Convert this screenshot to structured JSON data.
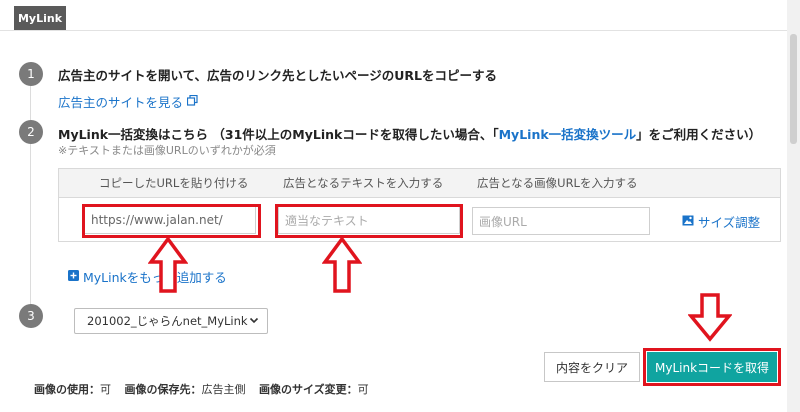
{
  "header": {
    "tab_label": "MyLink"
  },
  "step1": {
    "number": "1",
    "title": "広告主のサイトを開いて、広告のリンク先としたいページのURLをコピーする",
    "link": "広告主のサイトを見る",
    "link_icon": "external-link-icon"
  },
  "step2": {
    "number": "2",
    "title_prefix": "MyLink一括変換はこちら （31件以上のMyLinkコードを取得したい場合、「",
    "title_link": "MyLink一括変換ツール",
    "title_suffix": "」をご利用ください）",
    "note": "※テキストまたは画像URLのいずれかが必須",
    "columns": [
      "コピーしたURLを貼り付ける",
      "広告となるテキストを入力する",
      "広告となる画像URLを入力する"
    ],
    "url_value": "https://www.jalan.net/",
    "text_placeholder": "適当なテキスト",
    "image_placeholder": "画像URL",
    "size_link": "サイズ調整",
    "size_icon": "image-icon",
    "add_link": "MyLinkをもっと追加する",
    "add_icon": "plus-square-icon"
  },
  "step3": {
    "number": "3",
    "select_value": "201002_じゃらんnet_MyLink",
    "select_icon": "chevron-down-icon"
  },
  "buttons": {
    "clear": "内容をクリア",
    "get": "MyLinkコードを取得"
  },
  "footer": {
    "usage_label": "画像の使用：",
    "usage_value": "可",
    "storage_label": "画像の保存先：",
    "storage_value": "広告主側",
    "resize_label": "画像のサイズ変更：",
    "resize_value": "可"
  },
  "colors": {
    "accent": "#10a4a0",
    "link": "#1a73c9",
    "highlight": "#e0141e"
  }
}
